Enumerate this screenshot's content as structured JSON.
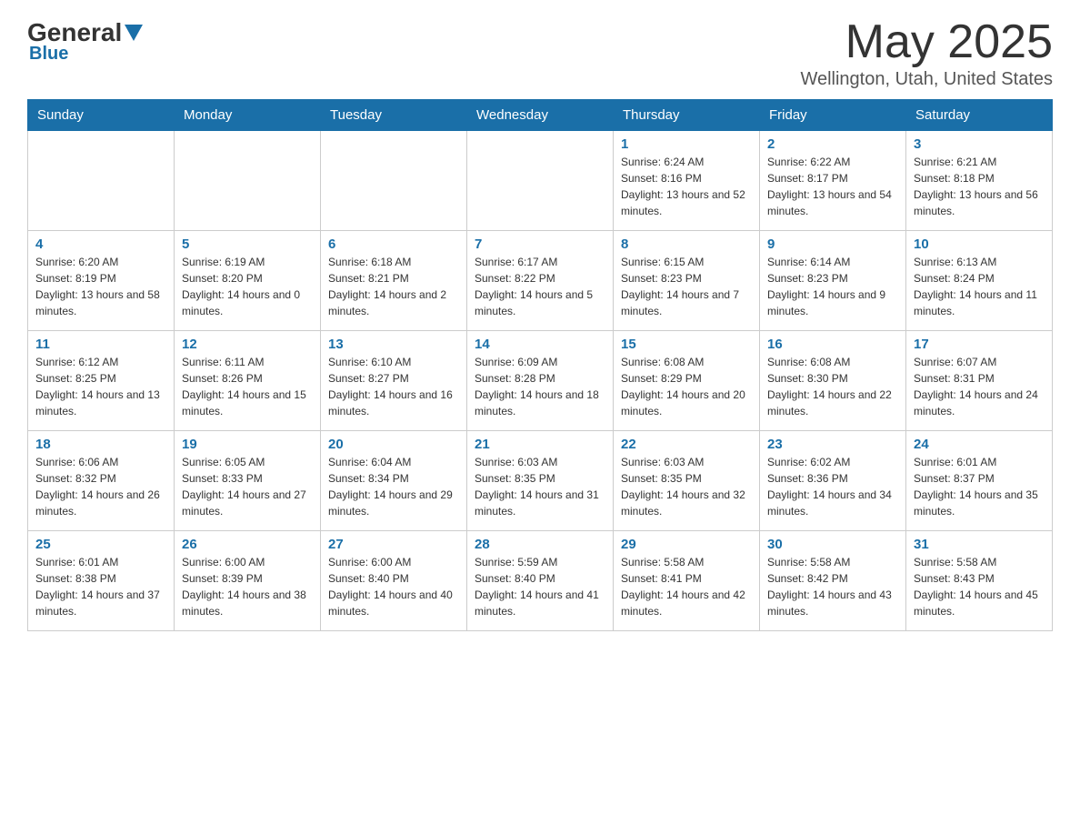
{
  "logo": {
    "general": "General",
    "blue": "Blue"
  },
  "header": {
    "month_year": "May 2025",
    "location": "Wellington, Utah, United States"
  },
  "days_of_week": [
    "Sunday",
    "Monday",
    "Tuesday",
    "Wednesday",
    "Thursday",
    "Friday",
    "Saturday"
  ],
  "weeks": [
    [
      {
        "day": "",
        "info": ""
      },
      {
        "day": "",
        "info": ""
      },
      {
        "day": "",
        "info": ""
      },
      {
        "day": "",
        "info": ""
      },
      {
        "day": "1",
        "info": "Sunrise: 6:24 AM\nSunset: 8:16 PM\nDaylight: 13 hours and 52 minutes."
      },
      {
        "day": "2",
        "info": "Sunrise: 6:22 AM\nSunset: 8:17 PM\nDaylight: 13 hours and 54 minutes."
      },
      {
        "day": "3",
        "info": "Sunrise: 6:21 AM\nSunset: 8:18 PM\nDaylight: 13 hours and 56 minutes."
      }
    ],
    [
      {
        "day": "4",
        "info": "Sunrise: 6:20 AM\nSunset: 8:19 PM\nDaylight: 13 hours and 58 minutes."
      },
      {
        "day": "5",
        "info": "Sunrise: 6:19 AM\nSunset: 8:20 PM\nDaylight: 14 hours and 0 minutes."
      },
      {
        "day": "6",
        "info": "Sunrise: 6:18 AM\nSunset: 8:21 PM\nDaylight: 14 hours and 2 minutes."
      },
      {
        "day": "7",
        "info": "Sunrise: 6:17 AM\nSunset: 8:22 PM\nDaylight: 14 hours and 5 minutes."
      },
      {
        "day": "8",
        "info": "Sunrise: 6:15 AM\nSunset: 8:23 PM\nDaylight: 14 hours and 7 minutes."
      },
      {
        "day": "9",
        "info": "Sunrise: 6:14 AM\nSunset: 8:23 PM\nDaylight: 14 hours and 9 minutes."
      },
      {
        "day": "10",
        "info": "Sunrise: 6:13 AM\nSunset: 8:24 PM\nDaylight: 14 hours and 11 minutes."
      }
    ],
    [
      {
        "day": "11",
        "info": "Sunrise: 6:12 AM\nSunset: 8:25 PM\nDaylight: 14 hours and 13 minutes."
      },
      {
        "day": "12",
        "info": "Sunrise: 6:11 AM\nSunset: 8:26 PM\nDaylight: 14 hours and 15 minutes."
      },
      {
        "day": "13",
        "info": "Sunrise: 6:10 AM\nSunset: 8:27 PM\nDaylight: 14 hours and 16 minutes."
      },
      {
        "day": "14",
        "info": "Sunrise: 6:09 AM\nSunset: 8:28 PM\nDaylight: 14 hours and 18 minutes."
      },
      {
        "day": "15",
        "info": "Sunrise: 6:08 AM\nSunset: 8:29 PM\nDaylight: 14 hours and 20 minutes."
      },
      {
        "day": "16",
        "info": "Sunrise: 6:08 AM\nSunset: 8:30 PM\nDaylight: 14 hours and 22 minutes."
      },
      {
        "day": "17",
        "info": "Sunrise: 6:07 AM\nSunset: 8:31 PM\nDaylight: 14 hours and 24 minutes."
      }
    ],
    [
      {
        "day": "18",
        "info": "Sunrise: 6:06 AM\nSunset: 8:32 PM\nDaylight: 14 hours and 26 minutes."
      },
      {
        "day": "19",
        "info": "Sunrise: 6:05 AM\nSunset: 8:33 PM\nDaylight: 14 hours and 27 minutes."
      },
      {
        "day": "20",
        "info": "Sunrise: 6:04 AM\nSunset: 8:34 PM\nDaylight: 14 hours and 29 minutes."
      },
      {
        "day": "21",
        "info": "Sunrise: 6:03 AM\nSunset: 8:35 PM\nDaylight: 14 hours and 31 minutes."
      },
      {
        "day": "22",
        "info": "Sunrise: 6:03 AM\nSunset: 8:35 PM\nDaylight: 14 hours and 32 minutes."
      },
      {
        "day": "23",
        "info": "Sunrise: 6:02 AM\nSunset: 8:36 PM\nDaylight: 14 hours and 34 minutes."
      },
      {
        "day": "24",
        "info": "Sunrise: 6:01 AM\nSunset: 8:37 PM\nDaylight: 14 hours and 35 minutes."
      }
    ],
    [
      {
        "day": "25",
        "info": "Sunrise: 6:01 AM\nSunset: 8:38 PM\nDaylight: 14 hours and 37 minutes."
      },
      {
        "day": "26",
        "info": "Sunrise: 6:00 AM\nSunset: 8:39 PM\nDaylight: 14 hours and 38 minutes."
      },
      {
        "day": "27",
        "info": "Sunrise: 6:00 AM\nSunset: 8:40 PM\nDaylight: 14 hours and 40 minutes."
      },
      {
        "day": "28",
        "info": "Sunrise: 5:59 AM\nSunset: 8:40 PM\nDaylight: 14 hours and 41 minutes."
      },
      {
        "day": "29",
        "info": "Sunrise: 5:58 AM\nSunset: 8:41 PM\nDaylight: 14 hours and 42 minutes."
      },
      {
        "day": "30",
        "info": "Sunrise: 5:58 AM\nSunset: 8:42 PM\nDaylight: 14 hours and 43 minutes."
      },
      {
        "day": "31",
        "info": "Sunrise: 5:58 AM\nSunset: 8:43 PM\nDaylight: 14 hours and 45 minutes."
      }
    ]
  ]
}
